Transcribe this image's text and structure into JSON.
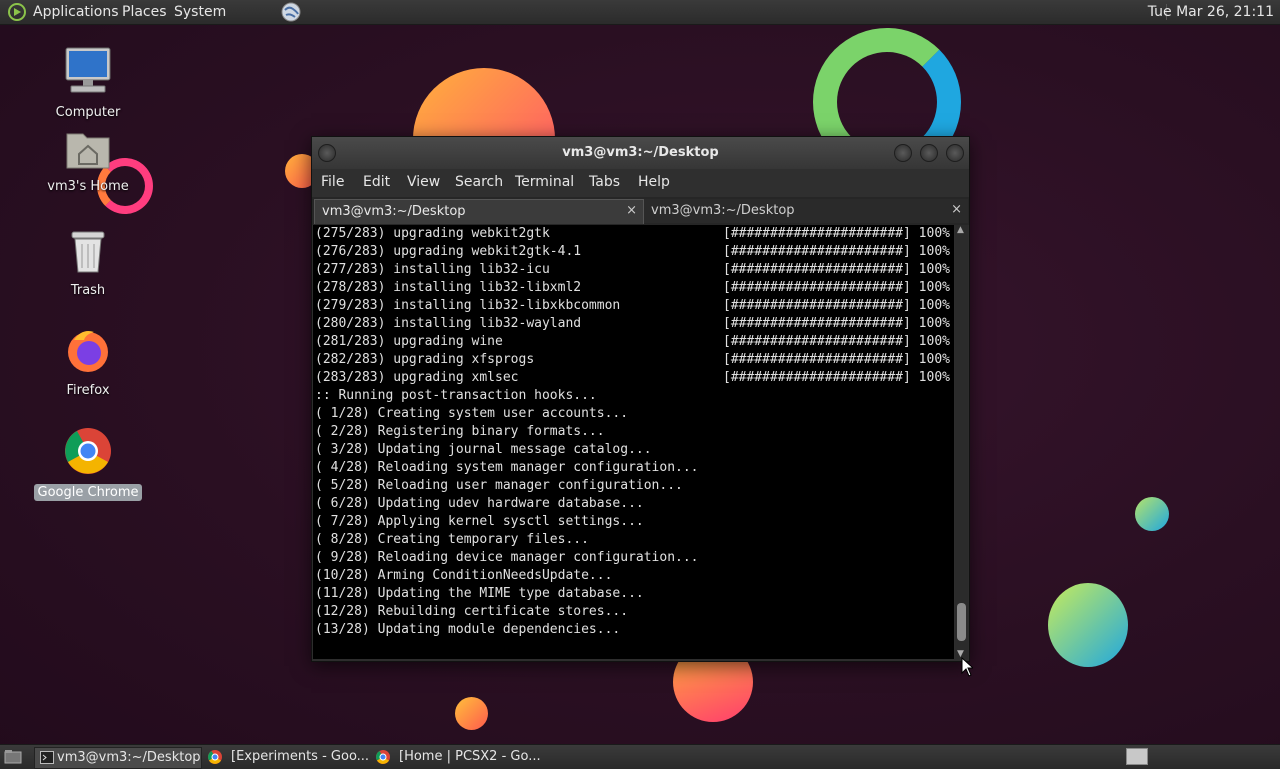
{
  "top_panel": {
    "menus": [
      "Applications",
      "Places",
      "System"
    ],
    "clock": "Tue Mar 26, 21:11"
  },
  "desktop_icons": [
    {
      "label": "Computer"
    },
    {
      "label": "vm3's Home"
    },
    {
      "label": "Trash"
    },
    {
      "label": "Firefox"
    },
    {
      "label": "Google Chrome"
    }
  ],
  "terminal": {
    "title": "vm3@vm3:~/Desktop",
    "menu": [
      "File",
      "Edit",
      "View",
      "Search",
      "Terminal",
      "Tabs",
      "Help"
    ],
    "tabs": [
      {
        "label": "vm3@vm3:~/Desktop",
        "close": "×"
      },
      {
        "label": "vm3@vm3:~/Desktop",
        "close": "×"
      }
    ],
    "lines": [
      {
        "text": "(275/283) upgrading webkit2gtk",
        "bar": "[######################] 100%"
      },
      {
        "text": "(276/283) upgrading webkit2gtk-4.1",
        "bar": "[######################] 100%"
      },
      {
        "text": "(277/283) installing lib32-icu",
        "bar": "[######################] 100%"
      },
      {
        "text": "(278/283) installing lib32-libxml2",
        "bar": "[######################] 100%"
      },
      {
        "text": "(279/283) installing lib32-libxkbcommon",
        "bar": "[######################] 100%"
      },
      {
        "text": "(280/283) installing lib32-wayland",
        "bar": "[######################] 100%"
      },
      {
        "text": "(281/283) upgrading wine",
        "bar": "[######################] 100%"
      },
      {
        "text": "(282/283) upgrading xfsprogs",
        "bar": "[######################] 100%"
      },
      {
        "text": "(283/283) upgrading xmlsec",
        "bar": "[######################] 100%"
      },
      {
        "text": ":: Running post-transaction hooks...",
        "bar": ""
      },
      {
        "text": "( 1/28) Creating system user accounts...",
        "bar": ""
      },
      {
        "text": "( 2/28) Registering binary formats...",
        "bar": ""
      },
      {
        "text": "( 3/28) Updating journal message catalog...",
        "bar": ""
      },
      {
        "text": "( 4/28) Reloading system manager configuration...",
        "bar": ""
      },
      {
        "text": "( 5/28) Reloading user manager configuration...",
        "bar": ""
      },
      {
        "text": "( 6/28) Updating udev hardware database...",
        "bar": ""
      },
      {
        "text": "( 7/28) Applying kernel sysctl settings...",
        "bar": ""
      },
      {
        "text": "( 8/28) Creating temporary files...",
        "bar": ""
      },
      {
        "text": "( 9/28) Reloading device manager configuration...",
        "bar": ""
      },
      {
        "text": "(10/28) Arming ConditionNeedsUpdate...",
        "bar": ""
      },
      {
        "text": "(11/28) Updating the MIME type database...",
        "bar": ""
      },
      {
        "text": "(12/28) Rebuilding certificate stores...",
        "bar": ""
      },
      {
        "text": "(13/28) Updating module dependencies...",
        "bar": ""
      }
    ]
  },
  "taskbar": {
    "tasks": [
      {
        "label": "vm3@vm3:~/Desktop",
        "icon": "terminal-icon"
      },
      {
        "label": "[Experiments - Goo...",
        "icon": "chrome-icon"
      },
      {
        "label": "[Home | PCSX2 - Go...",
        "icon": "chrome-icon"
      }
    ]
  },
  "colors": {
    "desktop_bg": "#2a0f22",
    "console_bg": "#000000",
    "panel_bg": "#333333"
  }
}
